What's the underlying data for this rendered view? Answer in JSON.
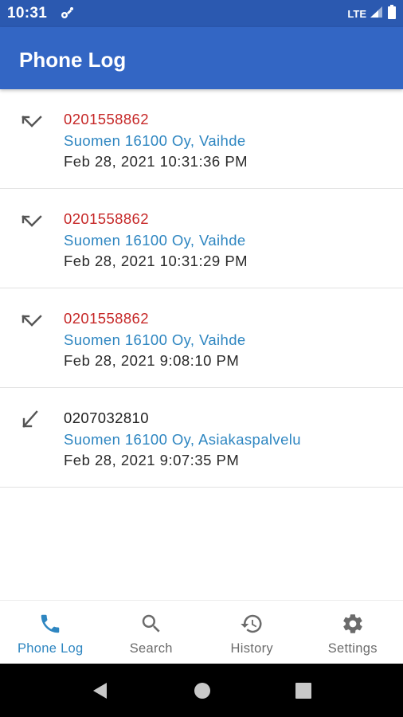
{
  "status_bar": {
    "time": "10:31",
    "network": "LTE"
  },
  "app_bar": {
    "title": "Phone Log"
  },
  "calls": [
    {
      "type": "missed",
      "icon": "missed-call-icon",
      "number": "0201558862",
      "number_color": "#c62828",
      "name": "Suomen 16100 Oy, Vaihde",
      "date": "Feb 28, 2021 10:31:36 PM"
    },
    {
      "type": "missed",
      "icon": "missed-call-icon",
      "number": "0201558862",
      "number_color": "#c62828",
      "name": "Suomen 16100 Oy, Vaihde",
      "date": "Feb 28, 2021 10:31:29 PM"
    },
    {
      "type": "missed",
      "icon": "missed-call-icon",
      "number": "0201558862",
      "number_color": "#c62828",
      "name": "Suomen 16100 Oy, Vaihde",
      "date": "Feb 28, 2021 9:08:10 PM"
    },
    {
      "type": "incoming",
      "icon": "incoming-call-icon",
      "number": "0207032810",
      "number_color": "#212121",
      "name": "Suomen 16100 Oy, Asiakaspalvelu",
      "date": "Feb 28, 2021 9:07:35 PM"
    }
  ],
  "bottom_nav": {
    "items": [
      {
        "label": "Phone Log",
        "icon": "phone-icon",
        "active": true
      },
      {
        "label": "Search",
        "icon": "search-icon",
        "active": false
      },
      {
        "label": "History",
        "icon": "history-icon",
        "active": false
      },
      {
        "label": "Settings",
        "icon": "gear-icon",
        "active": false
      }
    ]
  },
  "colors": {
    "status_bar": "#2b59b0",
    "app_bar": "#3366c4",
    "accent": "#2e86c1",
    "missed": "#c62828",
    "inactive": "#6b6b6b"
  }
}
